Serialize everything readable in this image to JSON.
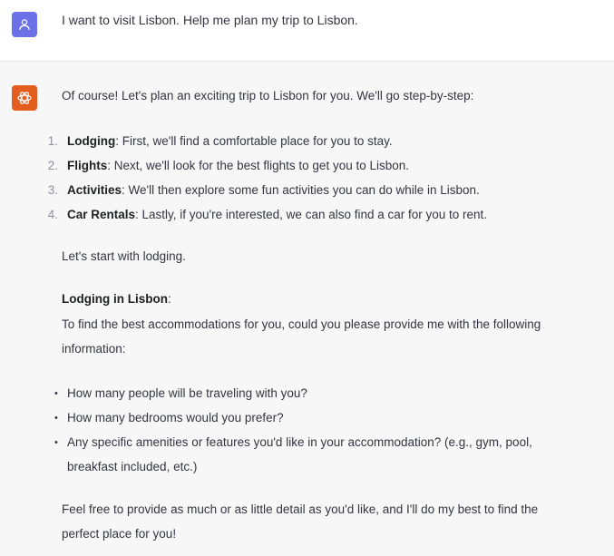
{
  "user_message": {
    "text": "I want to visit Lisbon. Help me plan my trip to Lisbon."
  },
  "assistant_message": {
    "intro": "Of course! Let's plan an exciting trip to Lisbon for you. We'll go step-by-step:",
    "steps": [
      {
        "number": "1.",
        "title": "Lodging",
        "text": ": First, we'll find a comfortable place for you to stay."
      },
      {
        "number": "2.",
        "title": "Flights",
        "text": ": Next, we'll look for the best flights to get you to Lisbon."
      },
      {
        "number": "3.",
        "title": "Activities",
        "text": ": We'll then explore some fun activities you can do while in Lisbon."
      },
      {
        "number": "4.",
        "title": "Car Rentals",
        "text": ": Lastly, if you're interested, we can also find a car for you to rent."
      }
    ],
    "start_line": "Let's start with lodging.",
    "section_title": "Lodging in Lisbon",
    "section_colon": ":",
    "request_line_1": "To find the best accommodations for you, could you please provide me with the following",
    "request_line_2": "information:",
    "questions": [
      "How many people will be traveling with you?",
      "How many bedrooms would you prefer?",
      "Any specific amenities or features you'd like in your accommodation? (e.g., gym, pool,"
    ],
    "question_3_cont": "breakfast included, etc.)",
    "closing_1": "Feel free to provide as much or as little detail as you'd like, and I'll do my best to find the",
    "closing_2": "perfect place for you!"
  },
  "icons": {
    "user_avatar": "user-icon",
    "assistant_avatar": "openai-logo-icon"
  },
  "colors": {
    "user_avatar_bg": "#6d71e8",
    "assistant_avatar_bg": "#e25d1f",
    "user_row_bg": "#ffffff",
    "assistant_row_bg": "#f7f7f8",
    "text": "#343541"
  }
}
